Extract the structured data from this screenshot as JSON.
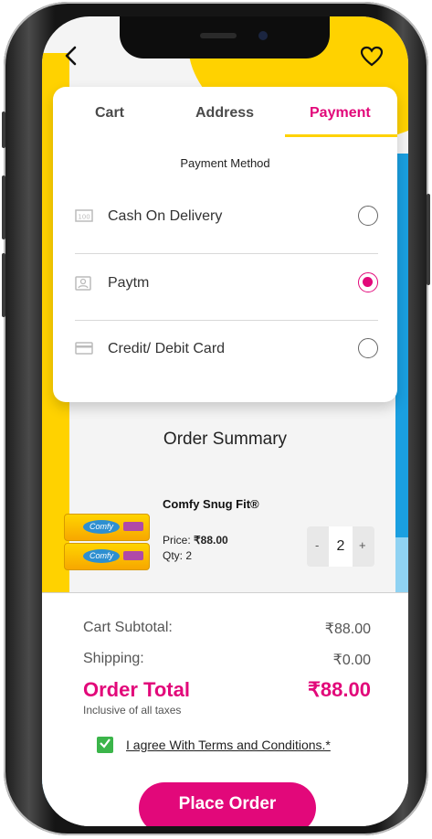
{
  "colors": {
    "accent": "#e2087a",
    "tab_underline": "#ffd200",
    "checkbox": "#3bb54a"
  },
  "header": {
    "back_icon": "chevron-left-icon",
    "favorite_icon": "heart-outline-icon"
  },
  "tabs": [
    {
      "label": "Cart",
      "active": false
    },
    {
      "label": "Address",
      "active": false
    },
    {
      "label": "Payment",
      "active": true
    }
  ],
  "payment": {
    "title": "Payment Method",
    "methods": [
      {
        "label": "Cash On Delivery",
        "icon": "cash-icon",
        "selected": false
      },
      {
        "label": "Paytm",
        "icon": "wallet-icon",
        "selected": true
      },
      {
        "label": "Credit/ Debit Card",
        "icon": "card-icon",
        "selected": false
      }
    ]
  },
  "order": {
    "title": "Order Summary",
    "product": {
      "name": "Comfy Snug Fit®",
      "brand": "Comfy",
      "price_label": "Price:",
      "price": "₹88.00",
      "qty_text": "Qty: 2",
      "qty": "2",
      "minus": "-",
      "plus": "+"
    }
  },
  "summary": {
    "subtotal_label": "Cart Subtotal:",
    "subtotal_value": "₹88.00",
    "shipping_label": "Shipping:",
    "shipping_value": "₹0.00",
    "total_label": "Order Total",
    "total_value": "₹88.00",
    "tax_note": "Inclusive of all taxes"
  },
  "terms": {
    "checked": true,
    "label": "I agree With Terms and Conditions.*"
  },
  "place_order_label": "Place Order"
}
